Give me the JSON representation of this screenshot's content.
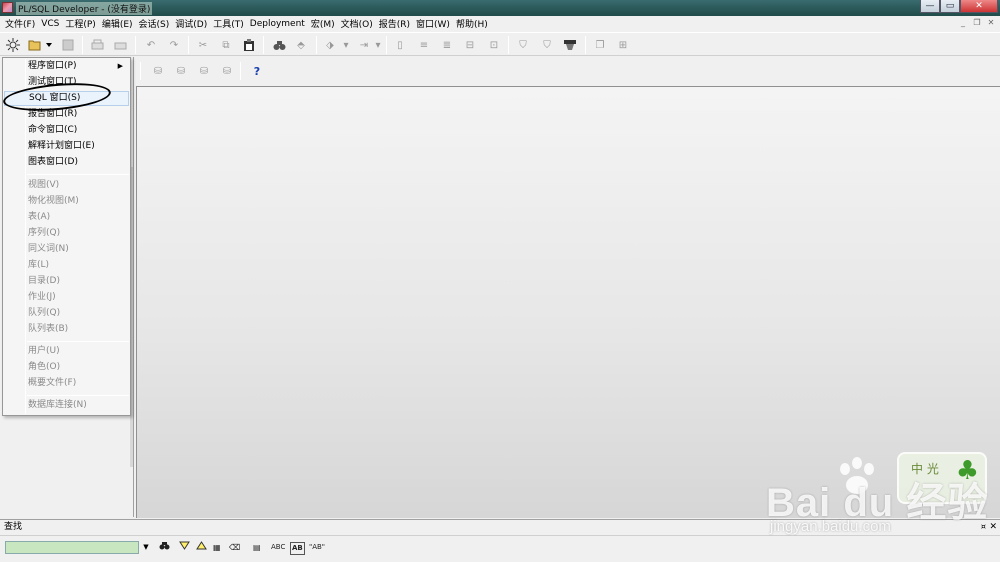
{
  "window": {
    "title": "PL/SQL Developer - (没有登录)",
    "min": "—",
    "max": "▭",
    "close": "✕"
  },
  "menubar": {
    "items": [
      "文件(F)",
      "VCS",
      "工程(P)",
      "编辑(E)",
      "会话(S)",
      "调试(D)",
      "工具(T)",
      "Deployment",
      "宏(M)",
      "文档(O)",
      "报告(R)",
      "窗口(W)",
      "帮助(H)"
    ],
    "mdi_minimize": "_",
    "mdi_restore": "❐",
    "mdi_close": "✕"
  },
  "dropdown": {
    "items": [
      {
        "label": "程序窗口(P)",
        "enabled": true,
        "submenu": true
      },
      {
        "label": "测试窗口(T)",
        "enabled": true
      },
      {
        "label": "SQL 窗口(S)",
        "enabled": true,
        "highlighted": true
      },
      {
        "label": "报告窗口(R)",
        "enabled": true
      },
      {
        "label": "命令窗口(C)",
        "enabled": true
      },
      {
        "label": "解释计划窗口(E)",
        "enabled": true
      },
      {
        "label": "图表窗口(D)",
        "enabled": true
      },
      {
        "label": "视图(V)",
        "enabled": false
      },
      {
        "label": "物化视图(M)",
        "enabled": false
      },
      {
        "label": "表(A)",
        "enabled": false
      },
      {
        "label": "序列(Q)",
        "enabled": false
      },
      {
        "label": "同义词(N)",
        "enabled": false
      },
      {
        "label": "库(L)",
        "enabled": false
      },
      {
        "label": "目录(D)",
        "enabled": false
      },
      {
        "label": "作业(J)",
        "enabled": false
      },
      {
        "label": "队列(Q)",
        "enabled": false
      },
      {
        "label": "队列表(B)",
        "enabled": false
      },
      {
        "label": "用户(U)",
        "enabled": false
      },
      {
        "label": "角色(O)",
        "enabled": false
      },
      {
        "label": "概要文件(F)",
        "enabled": false
      },
      {
        "label": "数据库连接(N)",
        "enabled": false
      }
    ]
  },
  "findbar": {
    "title": "查找",
    "pin": "¤",
    "close": "✕",
    "input_value": "",
    "dropdown": "▼",
    "abc_label": "ABC",
    "word_label": "AB",
    "quoted_label": "\"AB\""
  },
  "toolbar2": {
    "help": "?"
  },
  "watermark": {
    "text": "Bai du 经验",
    "url": "jingyan.baidu.com",
    "badge_text": "中 光"
  },
  "colors": {
    "find_input_bg": "#c8e6c0",
    "highlight_bg": "#eaf2fb",
    "disabled_text": "#8a8a8a"
  }
}
